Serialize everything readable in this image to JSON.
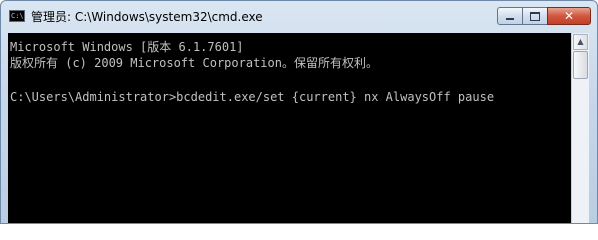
{
  "window": {
    "title": "管理员: C:\\Windows\\system32\\cmd.exe",
    "app_icon_text": "C:\\",
    "controls": {
      "minimize_icon": "minimize-icon",
      "maximize_icon": "maximize-icon",
      "close_label": "✕"
    }
  },
  "console": {
    "lines": [
      "Microsoft Windows [版本 6.1.7601]",
      "版权所有 (c) 2009 Microsoft Corporation。保留所有权利。",
      "",
      "C:\\Users\\Administrator>bcdedit.exe/set {current} nx AlwaysOff pause"
    ],
    "background": "#000000",
    "foreground": "#c0c0c0"
  },
  "scrollbar": {
    "up_arrow": "▲"
  }
}
